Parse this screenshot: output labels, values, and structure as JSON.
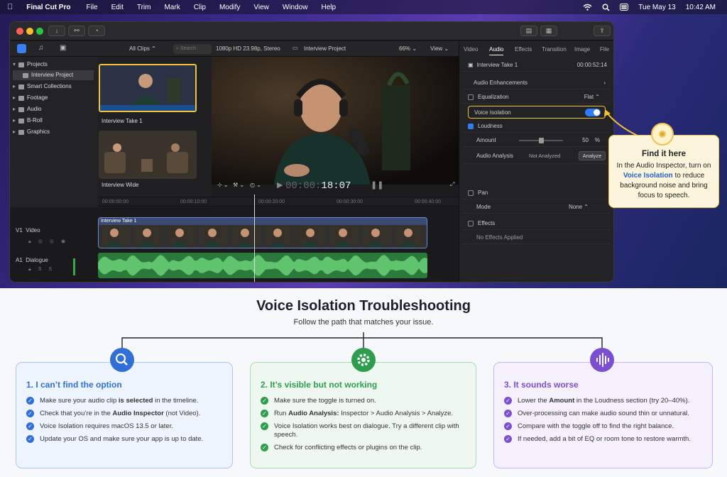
{
  "menubar": {
    "apple": "",
    "app": "Final Cut Pro",
    "items": [
      "File",
      "Edit",
      "Trim",
      "Mark",
      "Clip",
      "Modify",
      "View",
      "Window",
      "Help"
    ],
    "date": "Tue May 13",
    "time": "10:42 AM"
  },
  "browser": {
    "filter": "All Clips",
    "search_placeholder": "Search",
    "clips": [
      {
        "label": "Interview Take 1"
      },
      {
        "label": "Interview Wide"
      }
    ]
  },
  "library": {
    "items": [
      "Projects",
      "Interview Project",
      "Smart Collections",
      "Footage",
      "Audio",
      "B-Roll",
      "Graphics"
    ]
  },
  "viewer": {
    "format": "1080p HD 23.98p, Stereo",
    "project": "Interview Project",
    "zoom": "66%",
    "view": "View",
    "timecode_dim": "00:00:",
    "timecode_bright": "18:07"
  },
  "ruler": {
    "marks": [
      "00:00:00:00",
      "00:00:10:00",
      "00:00:20:00",
      "00:00:30:00",
      "00:00:40:00"
    ]
  },
  "timeline": {
    "v1": "V1",
    "v1_name": "Video",
    "a1": "A1",
    "a1_name": "Dialogue",
    "clip": "Interview Take 1"
  },
  "inspector": {
    "tabs": [
      "Video",
      "Audio",
      "Effects",
      "Transition",
      "Image",
      "File"
    ],
    "active_tab": "Audio",
    "clip_name": "Interview Take 1",
    "clip_time": "00:00:52:14",
    "enhancements": "Audio Enhancements",
    "equalization": "Equalization",
    "eq_value": "Flat",
    "voice_isolation": "Voice Isolation",
    "loudness": "Loudness",
    "amount": "Amount",
    "amount_value": "50",
    "amount_unit": "%",
    "amount_level": 0.5,
    "analysis": "Audio Analysis",
    "analysis_value": "Not Analyzed",
    "analyze_btn": "Analyze",
    "pan": "Pan",
    "mode": "Mode",
    "mode_value": "None",
    "effects": "Effects",
    "no_effects": "No Effects Applied"
  },
  "callout": {
    "title": "Find it here",
    "line1": "In the Audio Inspector, turn on",
    "highlight": "Voice Isolation",
    "line2": " to reduce background noise and bring focus to speech."
  },
  "guide": {
    "title": "Voice Isolation Troubleshooting",
    "subtitle": "Follow the path that matches your issue.",
    "colors": {
      "blue": "#2f6fd6",
      "green": "#2e9e4e",
      "purple": "#7b4fd0"
    },
    "cards": [
      {
        "title": "1. I can’t find the option",
        "items": [
          [
            "Make sure your audio clip ",
            "is selected",
            " in the timeline."
          ],
          [
            "Check that you’re in the ",
            "Audio Inspector",
            " (not Video)."
          ],
          [
            "Voice Isolation requires macOS 13.5 or later.",
            "",
            ""
          ],
          [
            "Update your OS and make sure your app is up to date.",
            "",
            ""
          ]
        ]
      },
      {
        "title": "2. It’s visible but not working",
        "items": [
          [
            "Make sure the toggle is turned on.",
            "",
            ""
          ],
          [
            "Run ",
            "Audio Analysis:",
            " Inspector > Audio Analysis > Analyze."
          ],
          [
            "Voice Isolation works best on dialogue. Try a different clip with speech.",
            "",
            ""
          ],
          [
            "Check for conflicting effects or plugins on the clip.",
            "",
            ""
          ]
        ]
      },
      {
        "title": "3. It sounds worse",
        "items": [
          [
            "Lower the ",
            "Amount",
            " in the Loudness section (try 20–40%)."
          ],
          [
            "Over-processing can make audio sound thin or unnatural.",
            "",
            ""
          ],
          [
            "Compare with the toggle off to find the right balance.",
            "",
            ""
          ],
          [
            "If needed, add a bit of EQ or room tone to restore warmth.",
            "",
            ""
          ]
        ]
      }
    ]
  }
}
